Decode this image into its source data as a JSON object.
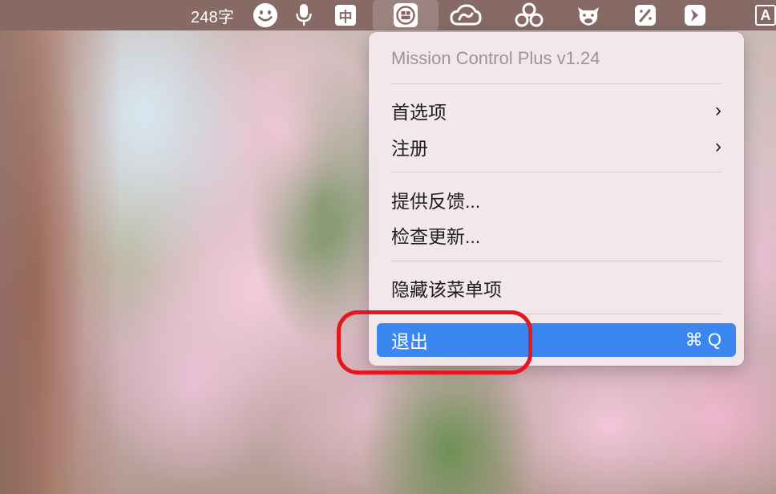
{
  "menubar": {
    "word_count": "248字",
    "input_method": "中",
    "icons": [
      "smiley-icon",
      "microphone-icon",
      "input-method-icon",
      "mission-control-icon",
      "creative-cloud-icon",
      "bubbles-icon",
      "cow-icon",
      "magic-wand-icon",
      "arrow-app-icon",
      "text-app-icon"
    ],
    "partial_label": "A"
  },
  "menu": {
    "title": "Mission Control Plus v1.24",
    "items": [
      {
        "label": "首选项",
        "has_submenu": true
      },
      {
        "label": "注册",
        "has_submenu": true
      },
      {
        "label": "提供反馈..."
      },
      {
        "label": "检查更新..."
      },
      {
        "label": "隐藏该菜单项"
      },
      {
        "label": "退出",
        "shortcut": "⌘ Q",
        "highlighted": true
      }
    ],
    "chevron": "›"
  },
  "colors": {
    "menubar": "#876a65",
    "highlight": "#3b87ef",
    "annotation": "#e5161d"
  }
}
